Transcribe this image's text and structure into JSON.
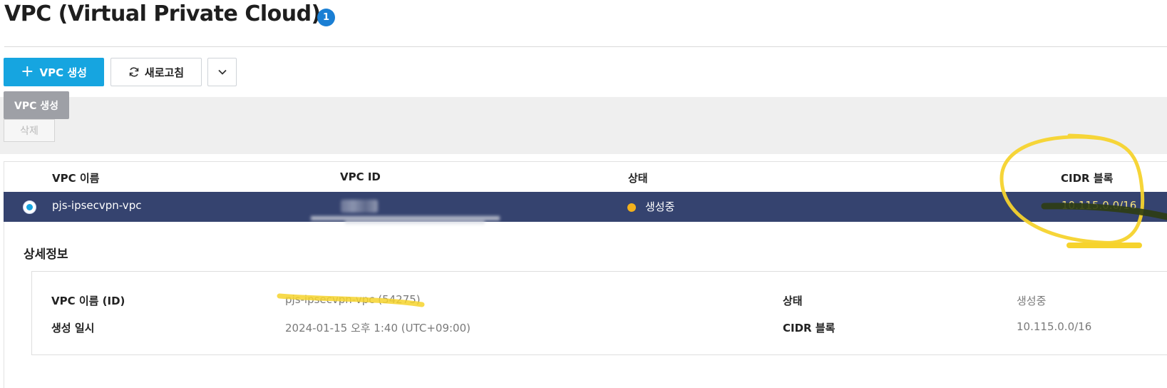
{
  "header": {
    "title": "VPC (Virtual Private Cloud)",
    "count": "1"
  },
  "toolbar": {
    "create_label": "VPC 생성",
    "refresh_label": "새로고침"
  },
  "actions": {
    "tooltip_label": "VPC 생성",
    "delete_label": "삭제"
  },
  "table": {
    "columns": [
      "VPC 이름",
      "VPC ID",
      "상태",
      "CIDR 블록"
    ],
    "rows": [
      {
        "name": "pjs-ipsecvpn-vpc",
        "status": "생성중",
        "cidr": "10.115.0.0/16"
      }
    ]
  },
  "details": {
    "title": "상세정보",
    "fields": [
      {
        "label": "VPC 이름 (ID)",
        "value": "pjs-ipsecvpn-vpc (54275)"
      },
      {
        "label": "생성 일시",
        "value": "2024-01-15 오후 1:40 (UTC+09:00)"
      },
      {
        "label": "상태",
        "value": "생성중"
      },
      {
        "label": "CIDR 블록",
        "value": "10.115.0.0/16"
      }
    ]
  },
  "colors": {
    "primary": "#16a5e0",
    "selected_row": "#35436f",
    "status_creating": "#f3b11c",
    "badge": "#1a7fd4",
    "annotation_highlight": "#f6d32d"
  },
  "icons": [
    "plus-icon",
    "refresh-icon",
    "chevron-down-icon",
    "radio-selected-icon",
    "status-dot-icon"
  ]
}
